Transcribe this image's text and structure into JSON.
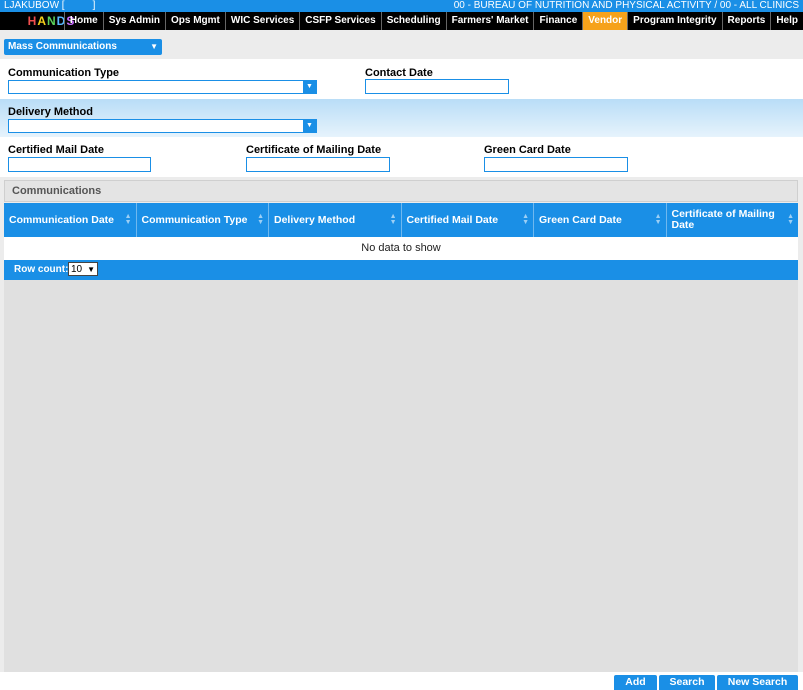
{
  "header": {
    "user": "LJAKUBOW [",
    "user_bracket_close": "]",
    "organization": "00 - BUREAU OF NUTRITION AND PHYSICAL ACTIVITY / 00 - ALL CLINICS",
    "logo_letters": [
      "H",
      "A",
      "N",
      "D",
      "S"
    ]
  },
  "nav": [
    "Home",
    "Sys Admin",
    "Ops Mgmt",
    "WIC Services",
    "CSFP Services",
    "Scheduling",
    "Farmers' Market",
    "Finance",
    "Vendor",
    "Program Integrity",
    "Reports",
    "Help"
  ],
  "nav_active": "Vendor",
  "module_select": {
    "value": "Mass Communications"
  },
  "form": {
    "communication_type_label": "Communication Type",
    "communication_type_value": "",
    "contact_date_label": "Contact Date",
    "contact_date_value": "",
    "delivery_method_label": "Delivery Method",
    "delivery_method_value": "",
    "certified_mail_date_label": "Certified Mail Date",
    "certified_mail_date_value": "",
    "certificate_of_mailing_date_label": "Certificate of Mailing Date",
    "certificate_of_mailing_date_value": "",
    "green_card_date_label": "Green Card Date",
    "green_card_date_value": ""
  },
  "grid": {
    "title": "Communications",
    "columns": [
      "Communication Date",
      "Communication Type",
      "Delivery Method",
      "Certified Mail Date",
      "Green Card Date",
      "Certificate of Mailing Date"
    ],
    "empty_text": "No data to show",
    "row_count_label": "Row count:",
    "row_count_value": "10"
  },
  "buttons": {
    "add": "Add",
    "search": "Search",
    "new_search": "New Search"
  },
  "colors": {
    "primary": "#1a8fe6",
    "active_nav": "#f6a21b"
  }
}
